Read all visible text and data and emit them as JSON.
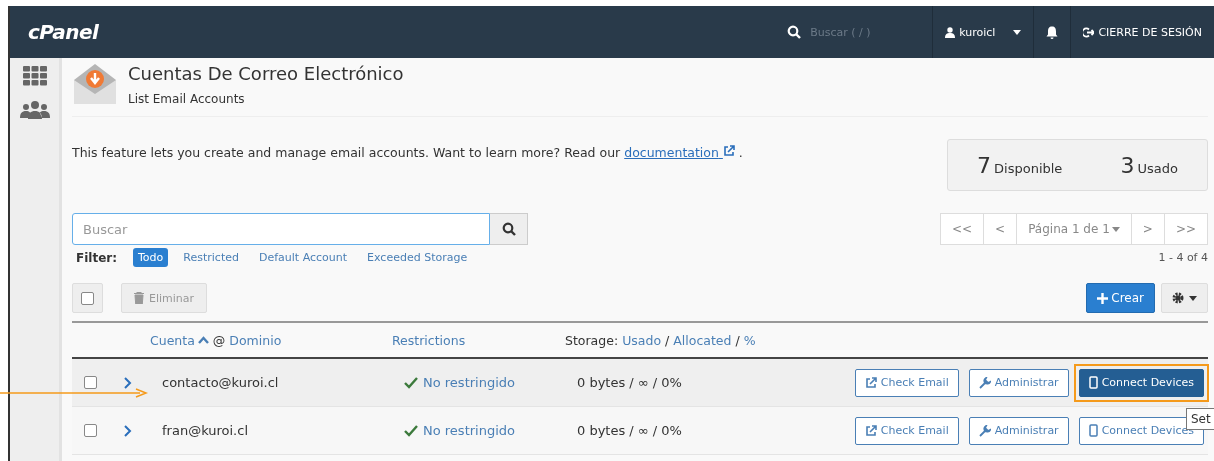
{
  "header": {
    "logo": "cPanel",
    "search_placeholder": "Buscar ( / )",
    "user": "kuroicl",
    "logout": "CIERRE DE SESIÓN"
  },
  "page": {
    "title": "Cuentas De Correo Electrónico",
    "subtitle": "List Email Accounts",
    "intro": "This feature lets you create and manage email accounts. Want to learn more? Read our",
    "intro_link": "documentation",
    "intro_end": "."
  },
  "stats": [
    {
      "number": "7",
      "label": "Disponible"
    },
    {
      "number": "3",
      "label": "Usado"
    }
  ],
  "search": {
    "placeholder": "Buscar"
  },
  "pagination": {
    "first": "<<",
    "prev": "<",
    "page": "Página 1 de 1",
    "next": ">",
    "last": ">>",
    "range": "1 - 4 of 4"
  },
  "filter": {
    "label": "Filter:",
    "options": [
      {
        "label": "Todo",
        "selected": true
      },
      {
        "label": "Restricted",
        "selected": false
      },
      {
        "label": "Default Account",
        "selected": false
      },
      {
        "label": "Exceeded Storage",
        "selected": false
      }
    ]
  },
  "toolbar": {
    "select_all_checked": false,
    "delete": "Eliminar",
    "create": "Crear"
  },
  "table": {
    "columns": {
      "account": "Cuenta",
      "at": "@",
      "domain": "Dominio",
      "restrictions": "Restrictions",
      "storage_prefix": "Storage:",
      "used": "Usado",
      "allocated": "Allocated",
      "percent": "%",
      "separators": [
        "/",
        "/"
      ]
    },
    "rows": [
      {
        "account": "contacto@kuroi.cl",
        "restriction": "No restringido",
        "storage": "0 bytes / ∞ / 0%",
        "checked": false,
        "hovered": true,
        "check_email": "Check Email",
        "manage": "Administrar",
        "connect": "Connect Devices"
      },
      {
        "account": "fran@kuroi.cl",
        "restriction": "No restringido",
        "storage": "0 bytes / ∞ / 0%",
        "checked": false,
        "hovered": false,
        "check_email": "Check Email",
        "manage": "Administrar",
        "connect": "Connect Devices"
      }
    ]
  },
  "tooltip": "Set"
}
